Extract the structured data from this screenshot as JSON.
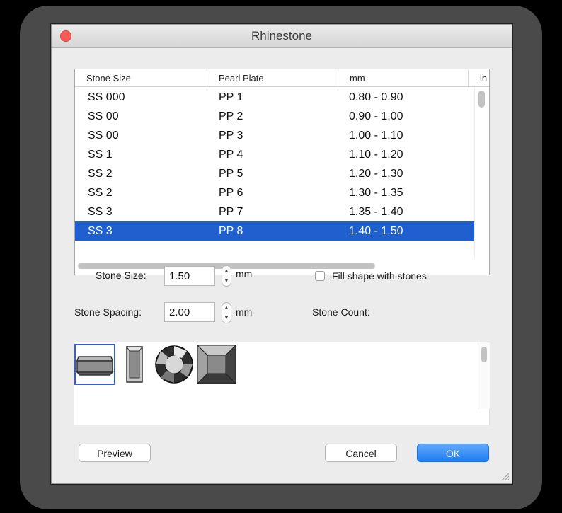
{
  "window": {
    "title": "Rhinestone"
  },
  "table": {
    "columns": [
      "Stone Size",
      "Pearl Plate",
      "mm",
      "in"
    ],
    "rows": [
      [
        "SS 000",
        "PP 1",
        "0.80 - 0.90"
      ],
      [
        "SS 00",
        "PP 2",
        "0.90 - 1.00"
      ],
      [
        "SS 00",
        "PP 3",
        "1.00 - 1.10"
      ],
      [
        "SS 1",
        "PP 4",
        "1.10 - 1.20"
      ],
      [
        "SS 2",
        "PP 5",
        "1.20 - 1.30"
      ],
      [
        "SS 2",
        "PP 6",
        "1.30 - 1.35"
      ],
      [
        "SS 3",
        "PP 7",
        "1.35 - 1.40"
      ],
      [
        "SS 3",
        "PP 8",
        "1.40 - 1.50"
      ]
    ],
    "selected_row": 7
  },
  "form": {
    "stone_size_label": "Stone Size:",
    "stone_size_value": "1.50",
    "stone_size_unit": "mm",
    "stone_spacing_label": "Stone Spacing:",
    "stone_spacing_value": "2.00",
    "stone_spacing_unit": "mm",
    "fill_label": "Fill shape with stones",
    "fill_checked": false,
    "count_label": "Stone Count:"
  },
  "shapes": {
    "items": [
      "flat-stone-side-icon",
      "flat-stone-front-icon",
      "round-cut-stone-icon",
      "square-cut-stone-icon"
    ],
    "selected": 0
  },
  "buttons": {
    "preview": "Preview",
    "cancel": "Cancel",
    "ok": "OK"
  },
  "colors": {
    "selection": "#1f5fd0",
    "ok_button": "#1c7ef5",
    "close_button": "#fc5b57"
  }
}
